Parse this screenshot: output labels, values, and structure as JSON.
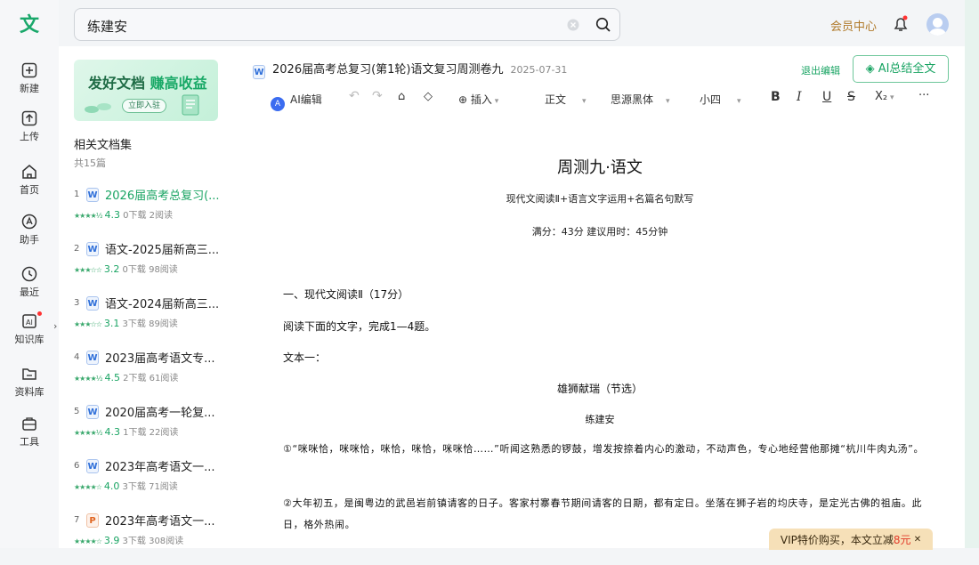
{
  "app": {
    "logo": "文",
    "brand_color": "#19a463"
  },
  "rail": [
    {
      "name": "new",
      "label": "新建",
      "icon": "plus-icon"
    },
    {
      "name": "upload",
      "label": "上传",
      "icon": "upload-icon"
    },
    {
      "name": "home",
      "label": "首页",
      "icon": "home-icon"
    },
    {
      "name": "assistant",
      "label": "助手",
      "icon": "assistant-icon"
    },
    {
      "name": "recent",
      "label": "最近",
      "icon": "clock-icon"
    },
    {
      "name": "knowledge",
      "label": "知识库",
      "icon": "ai-book-icon"
    },
    {
      "name": "library",
      "label": "资料库",
      "icon": "folder-icon"
    },
    {
      "name": "tools",
      "label": "工具",
      "icon": "toolbox-icon"
    }
  ],
  "search": {
    "query": "练建安"
  },
  "header": {
    "member": "会员中心"
  },
  "banner": {
    "title_a": "发好文档",
    "title_b": "赚高收益",
    "button": "立即入驻"
  },
  "collection": {
    "title": "相关文档集",
    "count": "共15篇"
  },
  "docs": [
    {
      "num": "1",
      "type": "W",
      "name": "2026届高考总复习(...",
      "score": "4.3",
      "meta": "0下载  2阅读",
      "stars": "★★★★½"
    },
    {
      "num": "2",
      "type": "W",
      "name": "语文-2025届新高三...",
      "score": "3.2",
      "meta": "0下载  98阅读",
      "stars": "★★★☆☆"
    },
    {
      "num": "3",
      "type": "W",
      "name": "语文-2024届新高三...",
      "score": "3.1",
      "meta": "3下载  89阅读",
      "stars": "★★★☆☆"
    },
    {
      "num": "4",
      "type": "W",
      "name": "2023届高考语文专...",
      "score": "4.5",
      "meta": "2下载  61阅读",
      "stars": "★★★★½"
    },
    {
      "num": "5",
      "type": "W",
      "name": "2020届高考一轮复...",
      "score": "4.3",
      "meta": "1下载  22阅读",
      "stars": "★★★★½"
    },
    {
      "num": "6",
      "type": "W",
      "name": "2023年高考语文一...",
      "score": "4.0",
      "meta": "3下载  71阅读",
      "stars": "★★★★☆"
    },
    {
      "num": "7",
      "type": "P",
      "name": "2023年高考语文一...",
      "score": "3.9",
      "meta": "3下载  308阅读",
      "stars": "★★★★☆"
    }
  ],
  "editor": {
    "doc_title": "2026届高考总复习(第1轮)语文复习周测卷九",
    "date": "2025-07-31",
    "exit": "退出编辑",
    "ai_summary": "AI总结全文",
    "toolbar": {
      "ai_edit": "AI编辑",
      "insert": "插入",
      "style": "正文",
      "font": "思源黑体",
      "size": "小四",
      "sub": "X₂",
      "more": "···"
    }
  },
  "paper": {
    "title": "周测九·语文",
    "subtitle": "现代文阅读Ⅱ+语言文字运用+名篇名句默写",
    "score_line": "满分：43分    建议用时：45分钟",
    "section": "一、现代文阅读Ⅱ（17分）",
    "instruction": "阅读下面的文字，完成1—4题。",
    "text_label": "文本一：",
    "article_title": "雄狮献瑞（节选）",
    "author": "练建安",
    "p1": "①“咪咪恰，咪咪恰，咪恰，咪恰，咪咪恰……”听闻这熟悉的锣鼓，增发按捺着内心的激动，不动声色，专心地经营他那摊“杭川牛肉丸汤”。",
    "p2": "②大年初五，是闽粤边的武邑岩前镇请客的日子。客家村寨春节期间请客的日期，都有定日。坐落在狮子岩的均庆寺，是定光古佛的祖庙。此日，格外热闹。"
  },
  "vip": {
    "text": "VIP特价购买，本文立减",
    "amount": "8元"
  }
}
